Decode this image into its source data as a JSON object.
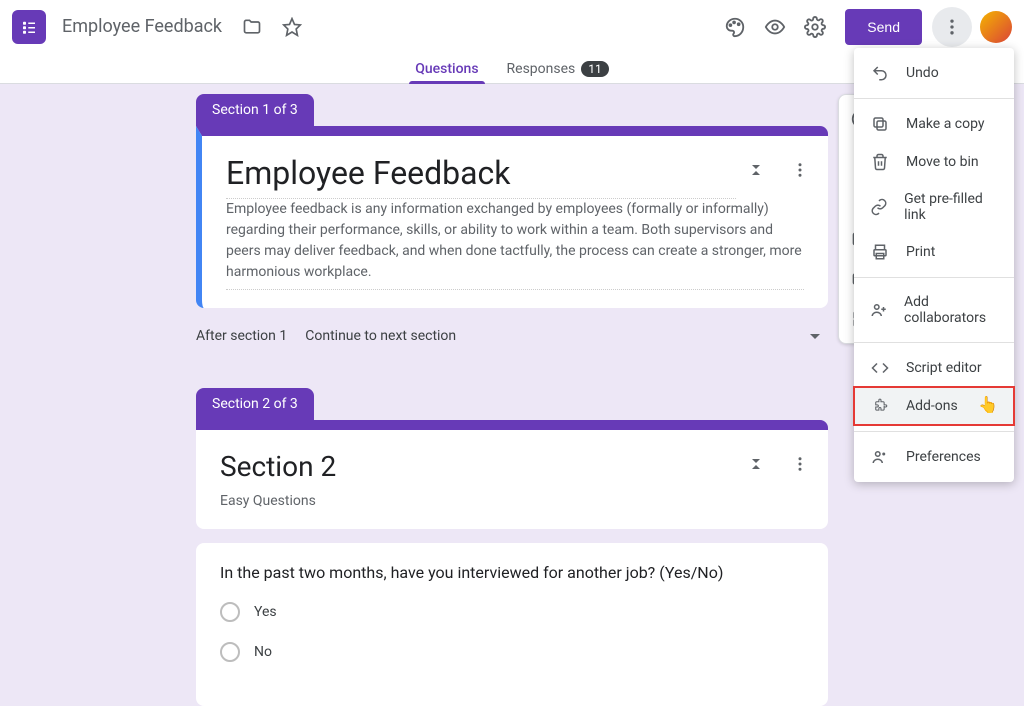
{
  "header": {
    "doc_title": "Employee Feedback",
    "send_label": "Send"
  },
  "tabs": {
    "questions": "Questions",
    "responses": "Responses",
    "responses_count": "11"
  },
  "section1": {
    "tab_label": "Section 1 of 3",
    "title": "Employee Feedback",
    "description": "Employee feedback is any information exchanged by employees (formally or informally) regarding their performance, skills, or ability to work within a team. Both supervisors and peers may deliver feedback, and when done tactfully, the process can create a stronger, more harmonious workplace."
  },
  "after_section": {
    "label": "After section 1",
    "value": "Continue to next section"
  },
  "section2": {
    "tab_label": "Section 2 of 3",
    "title": "Section 2",
    "description": "Easy Questions"
  },
  "question1": {
    "text": "In the past two months, have you interviewed for another job? (Yes/No)",
    "options": [
      "Yes",
      "No"
    ]
  },
  "menu": {
    "undo": "Undo",
    "make_copy": "Make a copy",
    "move_to_bin": "Move to bin",
    "prefilled": "Get pre-filled link",
    "print": "Print",
    "add_collaborators": "Add collaborators",
    "script_editor": "Script editor",
    "addons": "Add-ons",
    "preferences": "Preferences"
  }
}
